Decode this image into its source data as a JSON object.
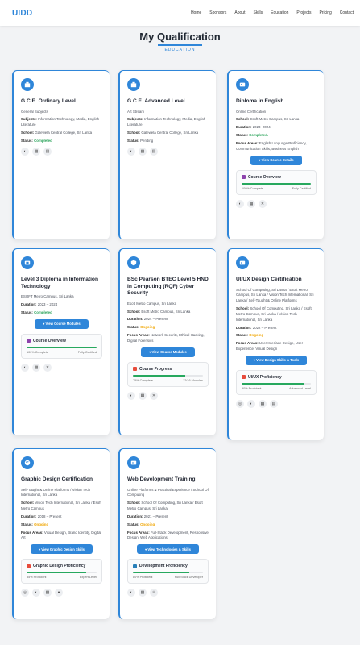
{
  "header": {
    "logo": "UIDD",
    "nav": [
      "Home",
      "Sponsors",
      "About",
      "Skills",
      "Education",
      "Projects",
      "Pricing",
      "Contact"
    ]
  },
  "section": {
    "title": "My Qualification",
    "subtitle": "EDUCATION"
  },
  "cards": [
    {
      "title": "G.C.E. Ordinary Level",
      "lines": [
        {
          "k": "",
          "v": "General Subjects"
        },
        {
          "k": "Subjects:",
          "v": "Information Technology, Media, English Literature"
        },
        {
          "k": "School:",
          "v": "Galewela Central College, Sri Lanka"
        },
        {
          "k": "Status:",
          "v": "Completed"
        }
      ],
      "icons": [
        "github-icon",
        "calendar-icon",
        "certificate-icon"
      ]
    },
    {
      "title": "G.C.E. Advanced Level",
      "lines": [
        {
          "k": "",
          "v": "Art Stream"
        },
        {
          "k": "Subjects:",
          "v": "Information Technology, Media, English Literature"
        },
        {
          "k": "School:",
          "v": "Galewela Central College, Sri Lanka"
        },
        {
          "k": "Status:",
          "v": "Pending"
        }
      ],
      "icons": [
        "github-icon",
        "calendar-icon",
        "certificate-icon"
      ]
    },
    {
      "title": "Diploma in English",
      "lines": [
        {
          "k": "",
          "v": "Online Certification"
        },
        {
          "k": "School:",
          "v": "Esoft Metro Campus, Sri Lanka"
        },
        {
          "k": "Duration:",
          "v": "2023–2024"
        },
        {
          "k": "Status:",
          "v": "Completed."
        },
        {
          "k": "Focus Areas:",
          "v": "English Language Proficiency, Communication Skills, Business English"
        }
      ],
      "button": "View Course Details",
      "progress": {
        "title": "Course Overview",
        "fill": 1.0,
        "left": "100% Complete",
        "right": "Fully Certified",
        "color": "#8e44ad"
      },
      "icons": [
        "github-icon",
        "calendar-icon",
        "close-icon"
      ]
    },
    {
      "title": "Level 3 Diploma in Information Technology",
      "lines": [
        {
          "k": "",
          "v": "ESOFT Metro Campus, Sri Lanka"
        },
        {
          "k": "Duration:",
          "v": "2023 – 2024"
        },
        {
          "k": "Status:",
          "v": "Completed"
        }
      ],
      "button": "View Course Modules",
      "progress": {
        "title": "Course Overview",
        "fill": 1.0,
        "left": "100% Complete",
        "right": "Fully Certified",
        "color": "#8e44ad"
      },
      "icons": [
        "github-icon",
        "calendar-icon",
        "close-icon"
      ]
    },
    {
      "title": "BSc Pearson BTEC Level 5 HND in Computing (RQF) Cyber Security",
      "lines": [
        {
          "k": "",
          "v": "Esoft Metro Campus, Sri Lanka"
        },
        {
          "k": "School:",
          "v": "Esoft Metro Campus, Sri Lanka"
        },
        {
          "k": "Duration:",
          "v": "2024 – Present"
        },
        {
          "k": "Status:",
          "v": "Ongoing"
        },
        {
          "k": "Focus Areas:",
          "v": "Network Security, Ethical Hacking, Digital Forensics"
        }
      ],
      "button": "View Course Modules",
      "progress": {
        "title": "Course Progress",
        "fill": 0.75,
        "left": "75% Complete",
        "right": "12/16 Modules",
        "color": "#e74c3c"
      },
      "icons": [
        "github-icon",
        "calendar-icon",
        "close-icon"
      ]
    },
    {
      "title": "UI/UX Design Certification",
      "lines": [
        {
          "k": "",
          "v": "School Of Computing, Sri Lanka / Esoft Metro Campus, Sri Lanka / Vision Tech International, Sri Lanka / Self-Taught & Online Platforms"
        },
        {
          "k": "School:",
          "v": "School Of Computing, Sri Lanka / Esoft Metro Campus, Sri Lanka / Vision Tech International, Sri Lanka"
        },
        {
          "k": "Duration:",
          "v": "2022 – Present"
        },
        {
          "k": "Status:",
          "v": "Ongoing"
        },
        {
          "k": "Focus Areas:",
          "v": "User Interface Design, User Experience, Visual Design"
        }
      ],
      "button": "View Design Skills & Tools",
      "progress": {
        "title": "UI/UX Proficiency",
        "fill": 0.9,
        "left": "90% Proficient",
        "right": "Advanced Level",
        "color": "#e74c3c"
      },
      "icons": [
        "figma-icon",
        "github-icon",
        "calendar-icon",
        "certificate-icon"
      ]
    },
    {
      "title": "Graphic Design Certification",
      "lines": [
        {
          "k": "",
          "v": "Self-Taught & Online Platforms / Vision Tech International, Sri Lanka"
        },
        {
          "k": "School:",
          "v": "Vision Tech International, Sri Lanka / Esoft Metro Campus"
        },
        {
          "k": "Duration:",
          "v": "2018 – Present"
        },
        {
          "k": "Status:",
          "v": "Ongoing"
        },
        {
          "k": "Focus Areas:",
          "v": "Visual Design, Brand Identity, Digital Art"
        }
      ],
      "button": "View Graphic Design Skills",
      "progress": {
        "title": "Graphic Design Proficiency",
        "fill": 0.85,
        "left": "85% Proficient",
        "right": "Expert Level",
        "color": "#e74c3c"
      },
      "icons": [
        "figma-icon",
        "github-icon",
        "calendar-icon",
        "palette-icon"
      ]
    },
    {
      "title": "Web Development Training",
      "lines": [
        {
          "k": "",
          "v": "Online Platforms & Practical Experience / School Of Computing"
        },
        {
          "k": "School:",
          "v": "School Of Computing, Sri Lanka / Esoft Metro Campus, Sri Lanka"
        },
        {
          "k": "Duration:",
          "v": "2021 – Present"
        },
        {
          "k": "Status:",
          "v": "Ongoing"
        },
        {
          "k": "Focus Areas:",
          "v": "Full-Stack Development, Responsive Design, Web Applications"
        }
      ],
      "button": "View Technologies & Skills",
      "progress": {
        "title": "Development Proficiency",
        "fill": 0.8,
        "left": "80% Proficient",
        "right": "Full-Stack Developer",
        "color": "#2980b9"
      },
      "icons": [
        "github-icon",
        "calendar-icon",
        "react-icon"
      ]
    }
  ]
}
